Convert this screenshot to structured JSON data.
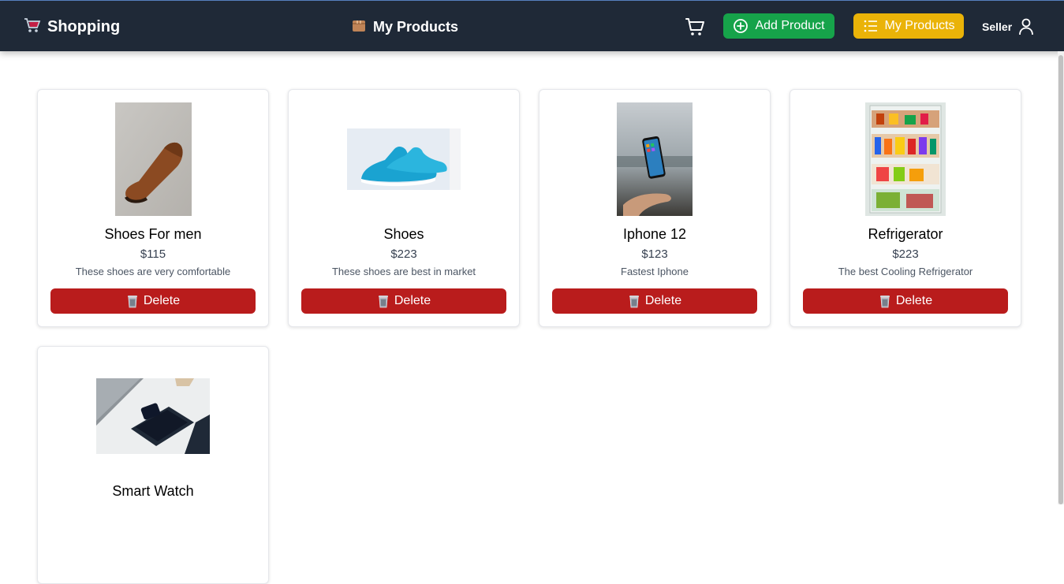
{
  "navbar": {
    "brand": "Shopping",
    "brand_icon": "shopping-cart-emoji-icon",
    "center_title": "My Products",
    "center_icon": "package-box-icon",
    "cart_icon": "cart-icon",
    "add_product": "Add Product",
    "my_products": "My Products",
    "seller": "Seller",
    "colors": {
      "bg": "#1f2937",
      "add": "#16a34a",
      "mine": "#eab308"
    }
  },
  "products": [
    {
      "name": "Shoes For men",
      "price": "$115",
      "description": "These shoes are very comfortable",
      "delete": "Delete"
    },
    {
      "name": "Shoes",
      "price": "$223",
      "description": "These shoes are best in market",
      "delete": "Delete"
    },
    {
      "name": "Iphone 12",
      "price": "$123",
      "description": "Fastest Iphone",
      "delete": "Delete"
    },
    {
      "name": "Refrigerator",
      "price": "$223",
      "description": "The best Cooling Refrigerator",
      "delete": "Delete"
    },
    {
      "name": "Smart Watch",
      "price": "",
      "description": "",
      "delete": ""
    }
  ],
  "colors": {
    "delete": "#b91c1c"
  }
}
